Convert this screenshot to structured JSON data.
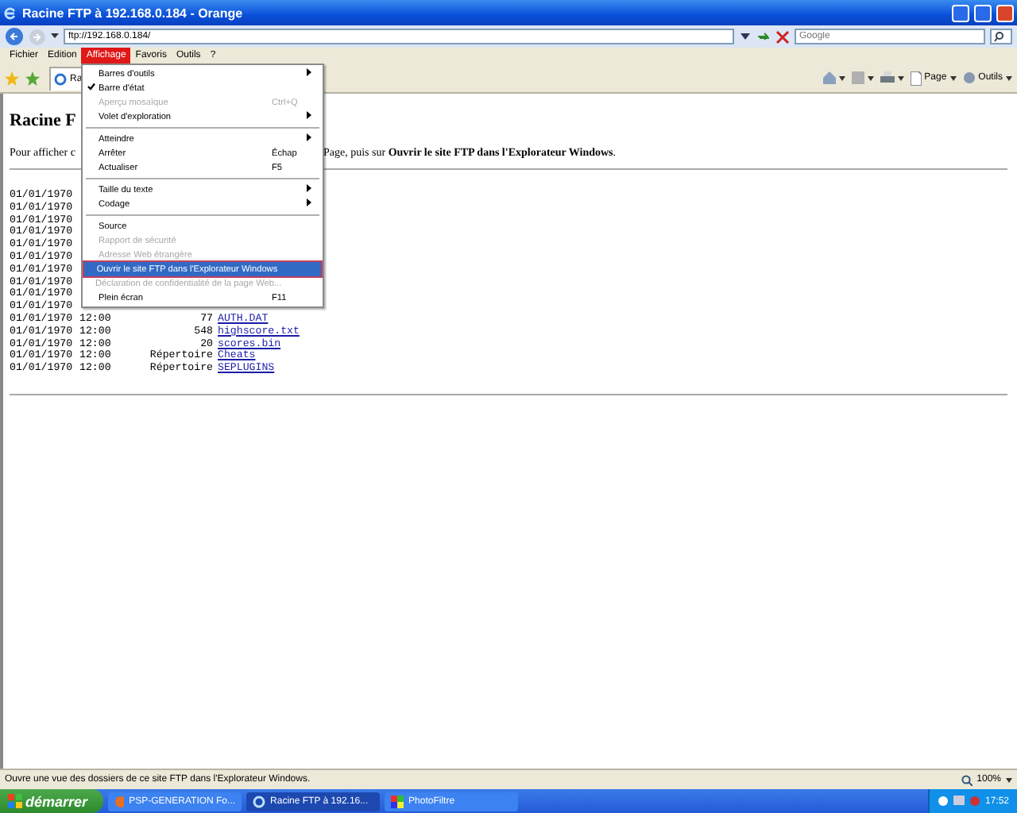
{
  "window": {
    "title": "Racine FTP à 192.168.0.184 - Orange"
  },
  "address_bar": {
    "value": "ftp://192.168.0.184/"
  },
  "search": {
    "placeholder": "Google"
  },
  "menu_bar": [
    {
      "label": "Fichier",
      "selected": false
    },
    {
      "label": "Edition",
      "selected": false
    },
    {
      "label": "Affichage",
      "selected": true
    },
    {
      "label": "Favoris",
      "selected": false
    },
    {
      "label": "Outils",
      "selected": false
    },
    {
      "label": "?",
      "selected": false
    }
  ],
  "tab": {
    "label": "Ra"
  },
  "command_bar": [
    {
      "kind": "home"
    },
    {
      "kind": "feeds"
    },
    {
      "kind": "print"
    },
    {
      "kind": "page",
      "label": "Page"
    },
    {
      "kind": "tools",
      "label": "Outils"
    }
  ],
  "page": {
    "heading": "Racine F",
    "intro_start": "Pour afficher c",
    "intro_end": "Page, puis sur **Ouvrir le site FTP dans l'Explorateur Windows**.",
    "listing": [
      {
        "date": "01/01/1970"
      },
      {
        "date": "01/01/1970"
      },
      {
        "date": "01/01/1970"
      },
      {
        "date": "01/01/1970"
      },
      {
        "date": "01/01/1970"
      },
      {
        "date": "01/01/1970"
      },
      {
        "date": "01/01/1970"
      },
      {
        "date": "01/01/1970"
      },
      {
        "date": "01/01/1970"
      },
      {
        "date": "01/01/1970"
      },
      {
        "date": "01/01/1970",
        "time": "12:00",
        "size": "77",
        "name": "AUTH.DAT"
      },
      {
        "date": "01/01/1970",
        "time": "12:00",
        "size": "548",
        "name": "highscore.txt"
      },
      {
        "date": "01/01/1970",
        "time": "12:00",
        "size": "20",
        "name": "scores.bin"
      },
      {
        "date": "01/01/1970",
        "time": "12:00",
        "size": "Répertoire",
        "name": "Cheats"
      },
      {
        "date": "01/01/1970",
        "time": "12:00",
        "size": "Répertoire",
        "name": "SEPLUGINS"
      }
    ]
  },
  "view_menu": [
    {
      "kind": "item",
      "label": "Barres d'outils",
      "submenu": true,
      "checked": false,
      "disabled": false,
      "selected": false
    },
    {
      "kind": "item",
      "label": "Barre d'état",
      "submenu": false,
      "checked": true,
      "disabled": false,
      "selected": false
    },
    {
      "kind": "item",
      "label": "Aperçu mosaïque",
      "shortcut": "Ctrl+Q",
      "submenu": false,
      "checked": false,
      "disabled": true,
      "selected": false
    },
    {
      "kind": "item",
      "label": "Volet d'exploration",
      "submenu": true,
      "checked": false,
      "disabled": false,
      "selected": false
    },
    {
      "kind": "separator"
    },
    {
      "kind": "item",
      "label": "Atteindre",
      "submenu": true,
      "checked": false,
      "disabled": false,
      "selected": false
    },
    {
      "kind": "item",
      "label": "Arrêter",
      "shortcut": "Échap",
      "submenu": false,
      "checked": false,
      "disabled": false,
      "selected": false
    },
    {
      "kind": "item",
      "label": "Actualiser",
      "shortcut": "F5",
      "submenu": false,
      "checked": false,
      "disabled": false,
      "selected": false
    },
    {
      "kind": "separator"
    },
    {
      "kind": "item",
      "label": "Taille du texte",
      "submenu": true,
      "checked": false,
      "disabled": false,
      "selected": false
    },
    {
      "kind": "item",
      "label": "Codage",
      "submenu": true,
      "checked": false,
      "disabled": false,
      "selected": false
    },
    {
      "kind": "separator"
    },
    {
      "kind": "item",
      "label": "Source",
      "submenu": false,
      "checked": false,
      "disabled": false,
      "selected": false
    },
    {
      "kind": "item",
      "label": "Rapport de sécurité",
      "submenu": false,
      "checked": false,
      "disabled": true,
      "selected": false
    },
    {
      "kind": "item",
      "label": "Adresse Web étrangère",
      "submenu": false,
      "checked": false,
      "disabled": true,
      "selected": false
    },
    {
      "kind": "item",
      "label": "Ouvrir le site FTP dans l'Explorateur Windows",
      "submenu": false,
      "checked": false,
      "disabled": false,
      "selected": true
    },
    {
      "kind": "item",
      "label": "Déclaration de confidentialité de la page Web...",
      "submenu": false,
      "checked": false,
      "disabled": true,
      "selected": false
    },
    {
      "kind": "item",
      "label": "Plein écran",
      "shortcut": "F11",
      "submenu": false,
      "checked": false,
      "disabled": false,
      "selected": false
    }
  ],
  "status_bar": {
    "text": "Ouvre une vue des dossiers de ce site FTP dans l'Explorateur Windows.",
    "zoom": "100%"
  },
  "taskbar": {
    "start": "démarrer",
    "tasks": [
      {
        "label": "PSP-GENERATION Fo...",
        "selected": false,
        "kind": "firefox"
      },
      {
        "label": "Racine FTP à 192.16...",
        "selected": true,
        "kind": "ie"
      },
      {
        "label": "PhotoFiltre",
        "selected": false,
        "kind": "photo"
      }
    ],
    "clock": "17:52"
  }
}
